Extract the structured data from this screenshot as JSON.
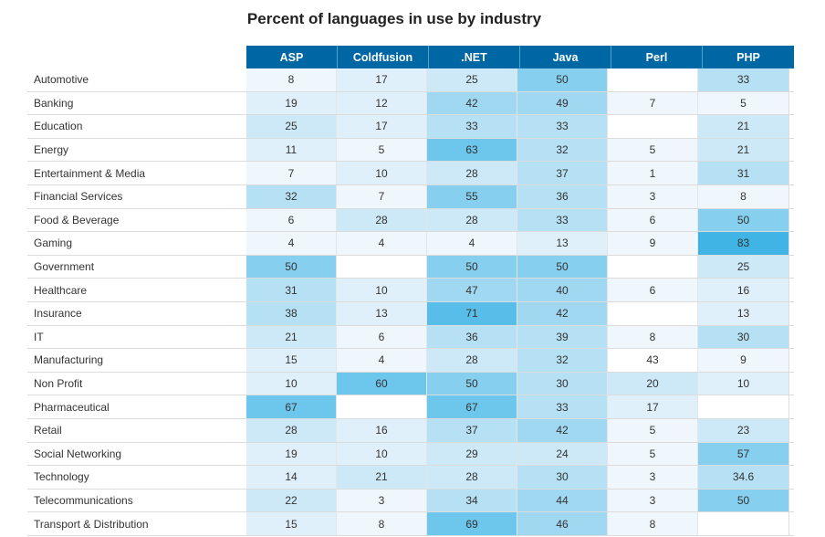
{
  "chart_data": {
    "type": "heatmap",
    "title": "Percent of languages in use by industry",
    "columns": [
      "ASP",
      "Coldfusion",
      ".NET",
      "Java",
      "Perl",
      "PHP"
    ],
    "rows": [
      {
        "label": "Automotive",
        "values": [
          8,
          17,
          25,
          50,
          null,
          33
        ]
      },
      {
        "label": "Banking",
        "values": [
          19,
          12,
          42,
          49,
          7,
          5
        ]
      },
      {
        "label": "Education",
        "values": [
          25,
          17,
          33,
          33,
          null,
          21
        ]
      },
      {
        "label": "Energy",
        "values": [
          11,
          5,
          63,
          32,
          5,
          21
        ]
      },
      {
        "label": "Entertainment & Media",
        "values": [
          7,
          10,
          28,
          37,
          1,
          31
        ]
      },
      {
        "label": "Financial Services",
        "values": [
          32,
          7,
          55,
          36,
          3,
          8
        ]
      },
      {
        "label": "Food & Beverage",
        "values": [
          6,
          28,
          28,
          33,
          6,
          50
        ]
      },
      {
        "label": "Gaming",
        "values": [
          4,
          4,
          4,
          13,
          9,
          83
        ]
      },
      {
        "label": "Government",
        "values": [
          50,
          null,
          50,
          50,
          null,
          25
        ]
      },
      {
        "label": "Healthcare",
        "values": [
          31,
          10,
          47,
          40,
          6,
          16
        ]
      },
      {
        "label": "Insurance",
        "values": [
          38,
          13,
          71,
          42,
          null,
          13
        ]
      },
      {
        "label": "IT",
        "values": [
          21,
          6,
          36,
          39,
          8,
          30
        ]
      },
      {
        "label": "Manufacturing",
        "values": [
          15,
          4,
          28,
          32,
          43,
          9
        ]
      },
      {
        "label": "Non Profit",
        "values": [
          10,
          60,
          50,
          30,
          20,
          10
        ]
      },
      {
        "label": "Pharmaceutical",
        "values": [
          67,
          null,
          67,
          33,
          17,
          null
        ]
      },
      {
        "label": "Retail",
        "values": [
          28,
          16,
          37,
          42,
          5,
          23
        ]
      },
      {
        "label": "Social Networking",
        "values": [
          19,
          10,
          29,
          24,
          5,
          57
        ]
      },
      {
        "label": "Technology",
        "values": [
          14,
          21,
          28,
          30,
          3,
          34.6
        ]
      },
      {
        "label": "Telecommunications",
        "values": [
          22,
          3,
          34,
          44,
          3,
          50
        ]
      },
      {
        "label": "Transport & Distribution",
        "values": [
          15,
          8,
          69,
          46,
          8,
          null
        ]
      }
    ],
    "color_scale": {
      "empty": "#ffffff",
      "bands": [
        {
          "min": 0,
          "color": "#f0f7fc"
        },
        {
          "min": 10,
          "color": "#dff0fa"
        },
        {
          "min": 20,
          "color": "#cde8f7"
        },
        {
          "min": 30,
          "color": "#b6e0f3"
        },
        {
          "min": 40,
          "color": "#a1d8f1"
        },
        {
          "min": 50,
          "color": "#86cfee"
        },
        {
          "min": 60,
          "color": "#6dc6ec"
        },
        {
          "min": 70,
          "color": "#58bde8"
        },
        {
          "min": 80,
          "color": "#3fb4e5"
        }
      ],
      "overrides": [
        {
          "row": "Manufacturing",
          "column": "Perl",
          "color": "#ffffff"
        }
      ]
    },
    "header_color": "#0067a5"
  }
}
